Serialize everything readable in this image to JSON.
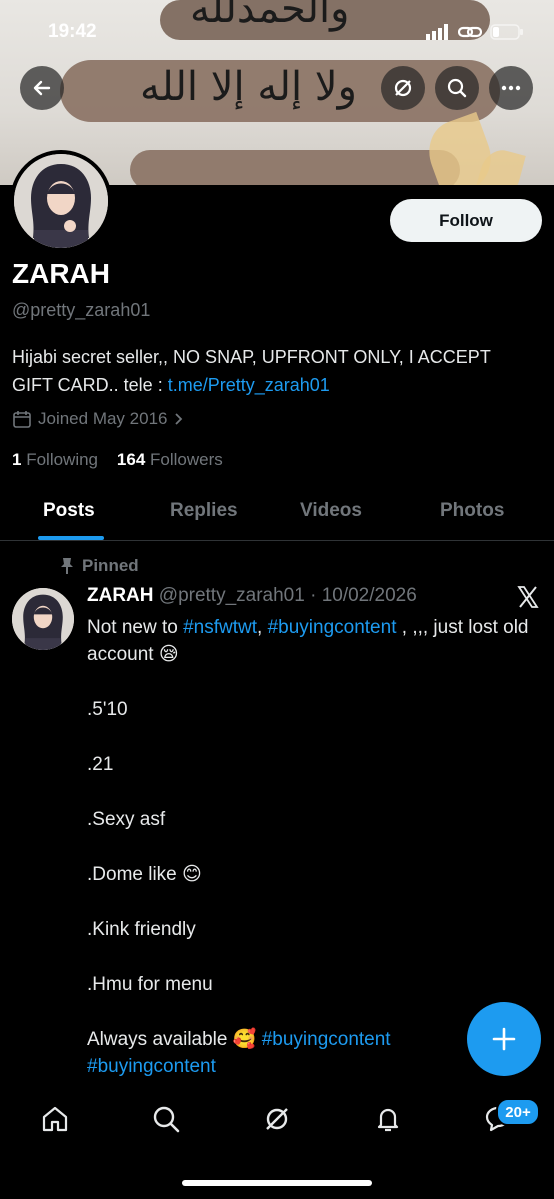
{
  "status": {
    "time": "19:42",
    "battery": "low"
  },
  "banner": {
    "calligraphy_top": "والحمدلله",
    "calligraphy_main": "ولا إله إلا الله"
  },
  "profile": {
    "name": "ZARAH",
    "handle": "@pretty_zarah01",
    "bio_text": "Hijabi secret seller,, NO SNAP, UPFRONT ONLY, I ACCEPT GIFT CARD.. tele : ",
    "bio_link": "t.me/Pretty_zarah01",
    "joined": "Joined May 2016",
    "following_count": "1",
    "following_label": "Following",
    "followers_count": "164",
    "followers_label": "Followers",
    "follow_button": "Follow"
  },
  "tabs": [
    {
      "label": "Posts",
      "active": true
    },
    {
      "label": "Replies",
      "active": false
    },
    {
      "label": "Videos",
      "active": false
    },
    {
      "label": "Photos",
      "active": false
    }
  ],
  "tweet": {
    "pinned_label": "Pinned",
    "author": "ZARAH",
    "meta": "@pretty_zarah01 · 10/02/2026",
    "line1_prefix": "Not new to ",
    "tag1": "#nsfwtwt",
    "sep": ", ",
    "tag2": "#buyingcontent",
    "line1_suffix": " , ,,, just lost old account",
    "emoji1": "😪",
    "item1": ".5'10",
    "item2": ".21",
    "item3": ".Sexy asf",
    "item4": ".Dome like",
    "emoji2": "😊",
    "item5": ".Kink friendly",
    "item6": ".Hmu for menu",
    "last_prefix": "Always available",
    "emoji3": "🥰",
    "tag3": "#buyingcontent",
    "tag4": "#buyingcontent"
  },
  "nav": {
    "messages_badge": "20+"
  },
  "colors": {
    "accent": "#1d9bf0",
    "background": "#000000",
    "muted": "#71767b"
  }
}
